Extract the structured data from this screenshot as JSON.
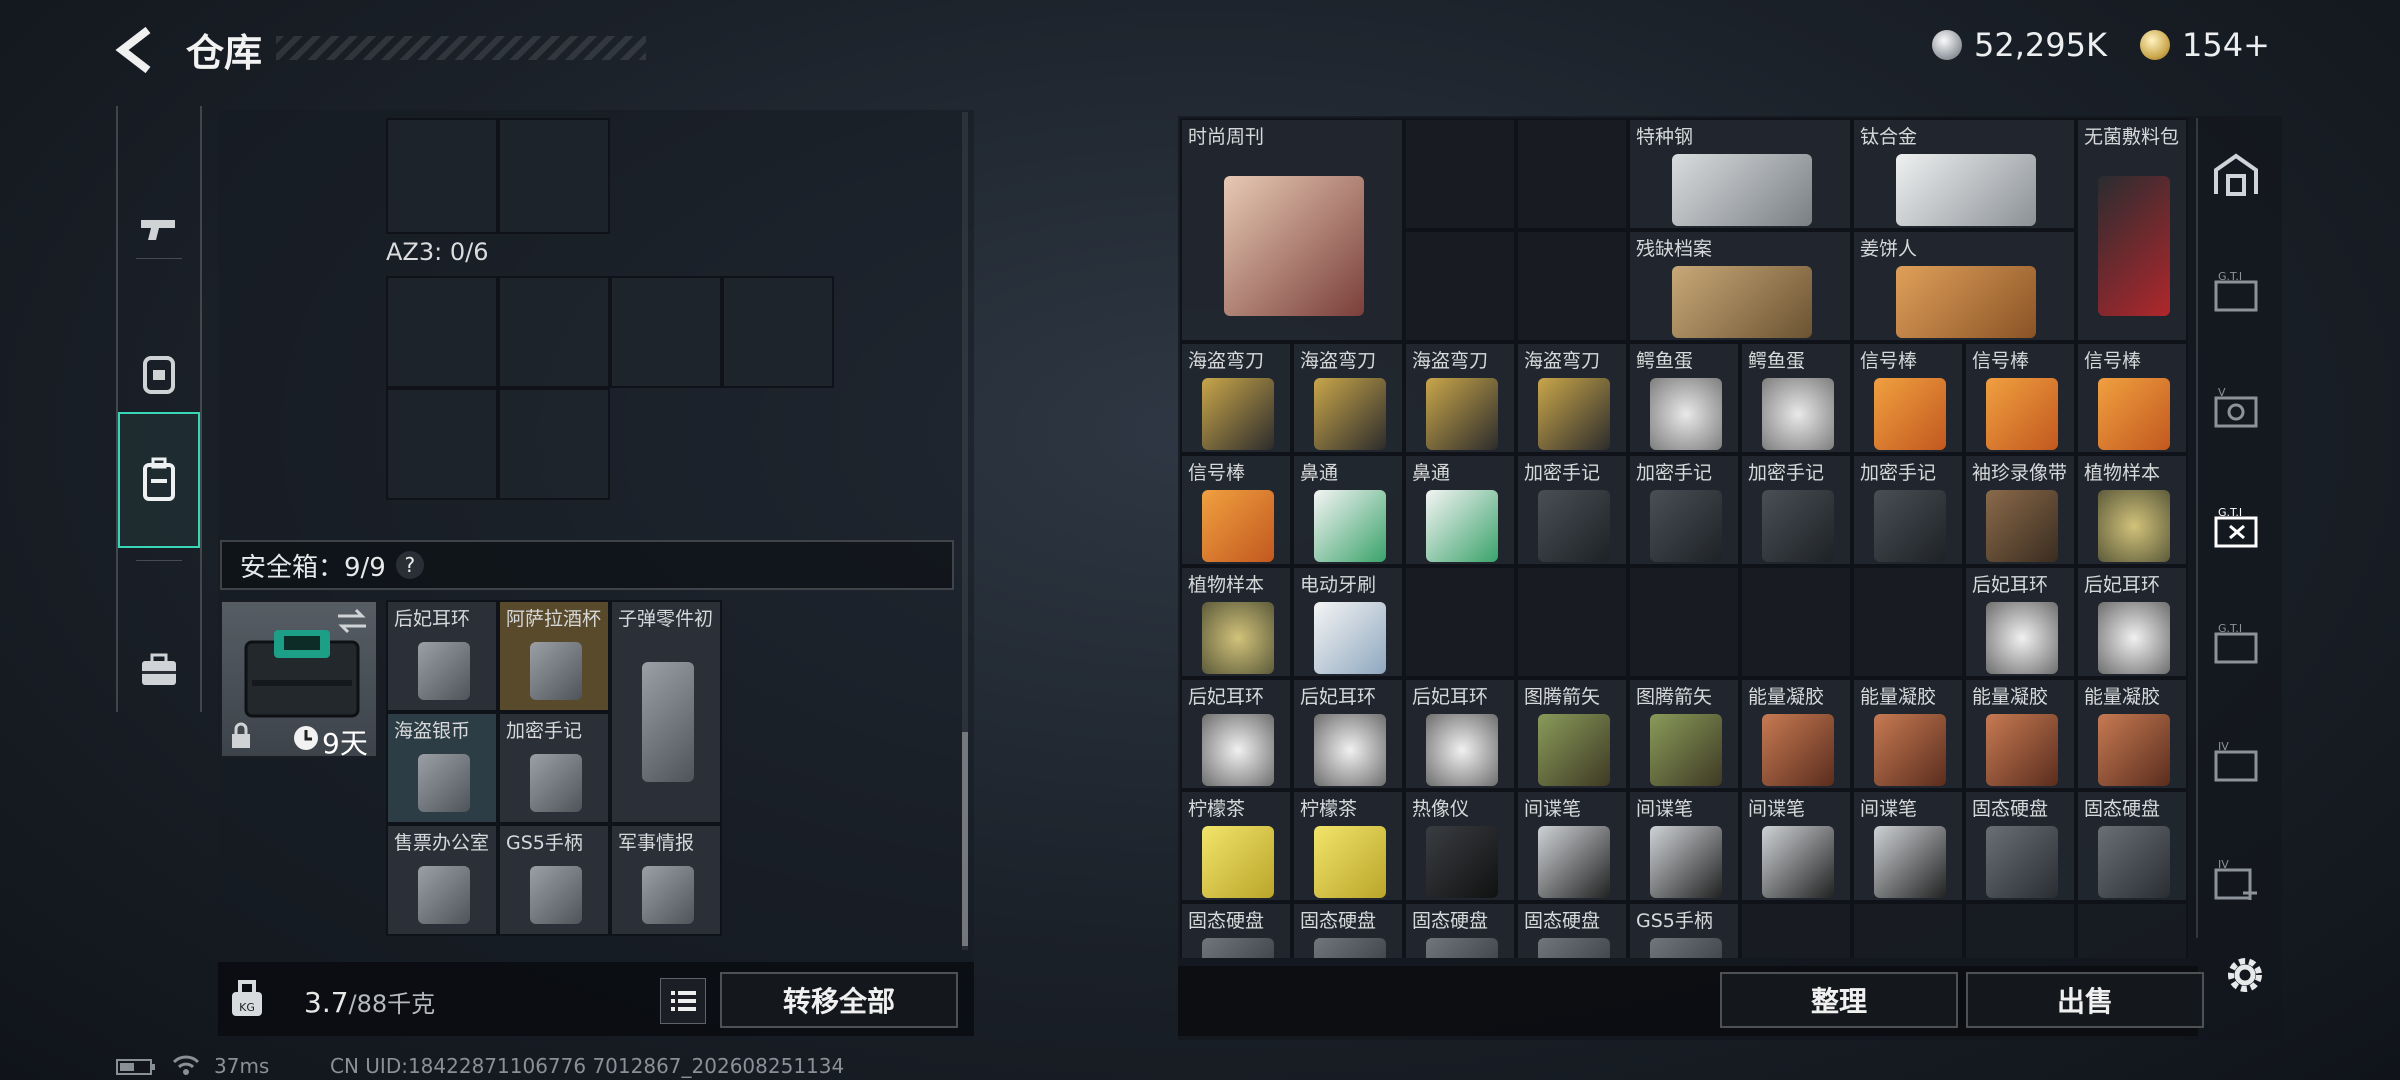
{
  "header": {
    "title": "仓库",
    "currency": {
      "silver": "52,295K",
      "gold": "154+"
    }
  },
  "left_nav": [
    "weapon-icon",
    "armor-icon",
    "backpack-icon",
    "briefcase-icon"
  ],
  "left": {
    "az3_label": "AZ3: 0/6",
    "safe_label": "安全箱：9/9",
    "help": "?",
    "case_timer": "9天",
    "safe_items": [
      "后妃耳环",
      "阿萨拉酒杯",
      "子弹零件初",
      "海盗银币",
      "加密手记",
      "售票办公室",
      "GS5手柄",
      "军事情报"
    ],
    "weight_value": "3.7",
    "weight_max": "/88千克",
    "transfer_all": "转移全部"
  },
  "right": {
    "items": {
      "magazine": "时尚周刊",
      "special_steel": "特种钢",
      "titanium": "钛合金",
      "sterile": "无菌敷料包",
      "archive": "残缺档案",
      "gingerbread": "姜饼人",
      "r3": [
        "海盗弯刀",
        "海盗弯刀",
        "海盗弯刀",
        "海盗弯刀",
        "鳄鱼蛋",
        "鳄鱼蛋",
        "信号棒",
        "信号棒",
        "信号棒"
      ],
      "r4": [
        "信号棒",
        "鼻通",
        "鼻通",
        "加密手记",
        "加密手记",
        "加密手记",
        "加密手记",
        "袖珍录像带",
        "植物样本"
      ],
      "r5a": [
        "植物样本",
        "电动牙刷"
      ],
      "r5b": [
        "后妃耳环",
        "后妃耳环"
      ],
      "r6": [
        "后妃耳环",
        "后妃耳环",
        "后妃耳环",
        "图腾箭矢",
        "图腾箭矢",
        "能量凝胶",
        "能量凝胶",
        "能量凝胶",
        "能量凝胶"
      ],
      "r7": [
        "柠檬茶",
        "柠檬茶",
        "热像仪",
        "间谍笔",
        "间谍笔",
        "间谍笔",
        "间谍笔",
        "固态硬盘",
        "固态硬盘"
      ],
      "r8": [
        "固态硬盘",
        "固态硬盘",
        "固态硬盘",
        "固态硬盘",
        "GS5手柄"
      ]
    },
    "sort": "整理",
    "sell": "出售"
  },
  "status": {
    "ping": "37ms",
    "uid": "CN UID:18422871106776 7012867_202608251134"
  }
}
